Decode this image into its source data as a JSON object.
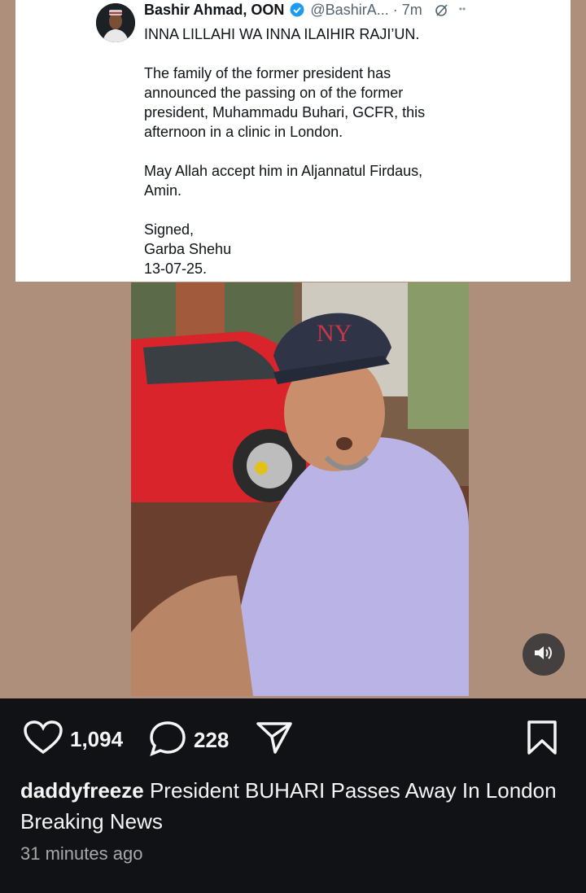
{
  "tweet": {
    "name": "Bashir Ahmad, OON",
    "handle": "@BashirA...",
    "time": "· 7m",
    "paragraphs": [
      "INNA LILLAHI WA INNA ILAIHIR RAJI’UN.",
      "The family of the former president has\nannounced the passing on of the former\npresident, Muhammadu Buhari, GCFR, this\nafternoon in a clinic in London.",
      "May Allah accept him in Aljannatul Firdaus,\nAmin.",
      "Signed,\nGarba Shehu\n13-07-25."
    ]
  },
  "actions": {
    "likes": "1,094",
    "comments": "228"
  },
  "caption": {
    "username": "daddyfreeze",
    "text": "President BUHARI Passes Away In London Breaking News"
  },
  "timestamp": "31 minutes ago",
  "icons": [
    "heart-icon",
    "comment-icon",
    "share-icon",
    "bookmark-icon",
    "sound-on-icon",
    "verified-badge-icon",
    "grok-icon",
    "more-icon"
  ],
  "colors": {
    "background": "#101216",
    "media_background": "#ae8f7b",
    "verified": "#1d9bf0",
    "car": "#d9242c",
    "shirt": "#b9b3e6"
  }
}
